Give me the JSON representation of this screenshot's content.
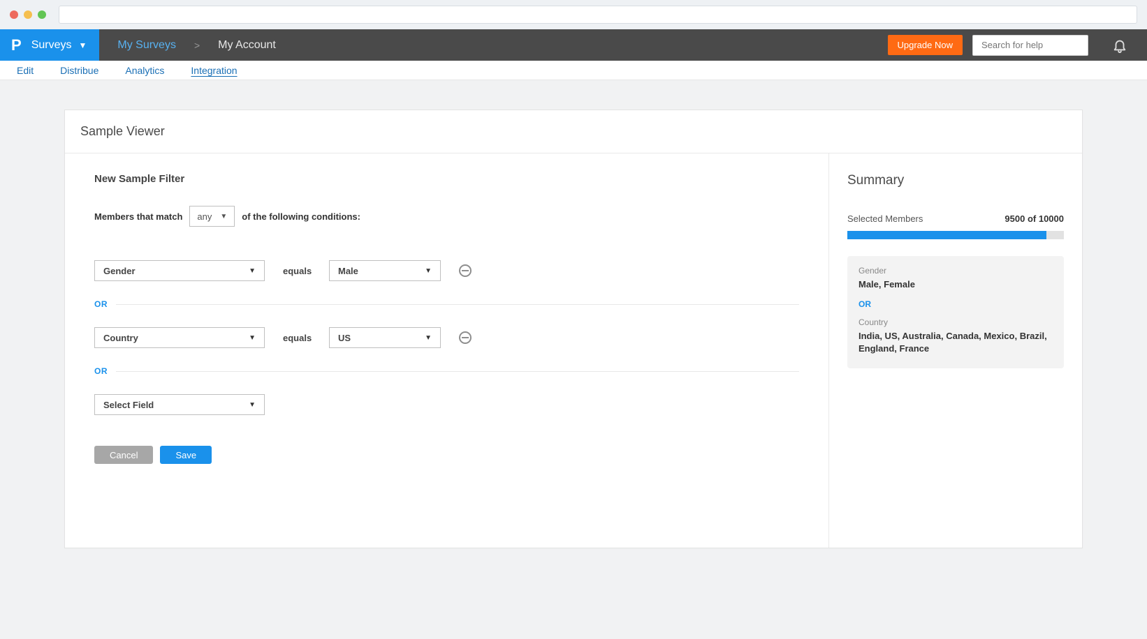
{
  "top": {
    "brand_label": "Surveys",
    "breadcrumb": {
      "a": "My Surveys",
      "sep": ">",
      "b": "My Account"
    },
    "upgrade_label": "Upgrade Now",
    "search_placeholder": "Search for help"
  },
  "subnav": {
    "tabs": [
      "Edit",
      "Distribue",
      "Analytics",
      "Integration"
    ],
    "active_index": 3
  },
  "panel": {
    "title": "Sample Viewer"
  },
  "filter": {
    "heading": "New Sample Filter",
    "match_prefix": "Members that match",
    "match_mode": "any",
    "match_suffix": "of the following conditions:",
    "or_label": "OR",
    "conditions": [
      {
        "field": "Gender",
        "operator": "equals",
        "value": "Male"
      },
      {
        "field": "Country",
        "operator": "equals",
        "value": "US"
      }
    ],
    "blank_field_placeholder": "Select Field",
    "cancel_label": "Cancel",
    "save_label": "Save"
  },
  "summary": {
    "title": "Summary",
    "selected_label": "Selected Members",
    "selected_count_text": "9500 of 10000",
    "progress_pct": 92,
    "groups": [
      {
        "label": "Gender",
        "value": "Male, Female"
      },
      {
        "label": "Country",
        "value": "India, US, Australia, Canada, Mexico, Brazil, England, France"
      }
    ],
    "or_label": "OR"
  }
}
